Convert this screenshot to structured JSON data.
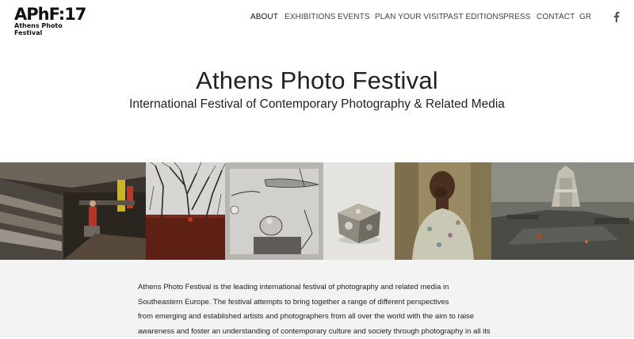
{
  "logo": {
    "main": "APhF:17",
    "sub": "Athens Photo Festival"
  },
  "nav": {
    "items": [
      "ABOUT",
      "EXHIBITIONS",
      "EVENTS",
      "PLAN YOUR VISIT",
      "PAST EDITIONS",
      "PRESS",
      "CONTACT",
      "GR"
    ],
    "active": "ABOUT",
    "social_icon": "facebook-icon"
  },
  "hero": {
    "title": "Athens Photo Festival",
    "subtitle": "International Festival of Contemporary Photography & Related Media"
  },
  "gallery": {
    "photos": [
      "supermarket-photo",
      "trees-photo",
      "drawing-photo",
      "cube-photo",
      "child-photo",
      "ruins-photo"
    ]
  },
  "description": {
    "lines": [
      "Athens Photo Festival is the leading international festival of photography and related media in",
      "Southeastern Europe. The festival attempts to bring together a range of different perspectives",
      "from emerging and established artists and photographers from all over the world with the aim to raise",
      "awareness and foster an understanding of contemporary culture and society through photography in all its"
    ]
  }
}
